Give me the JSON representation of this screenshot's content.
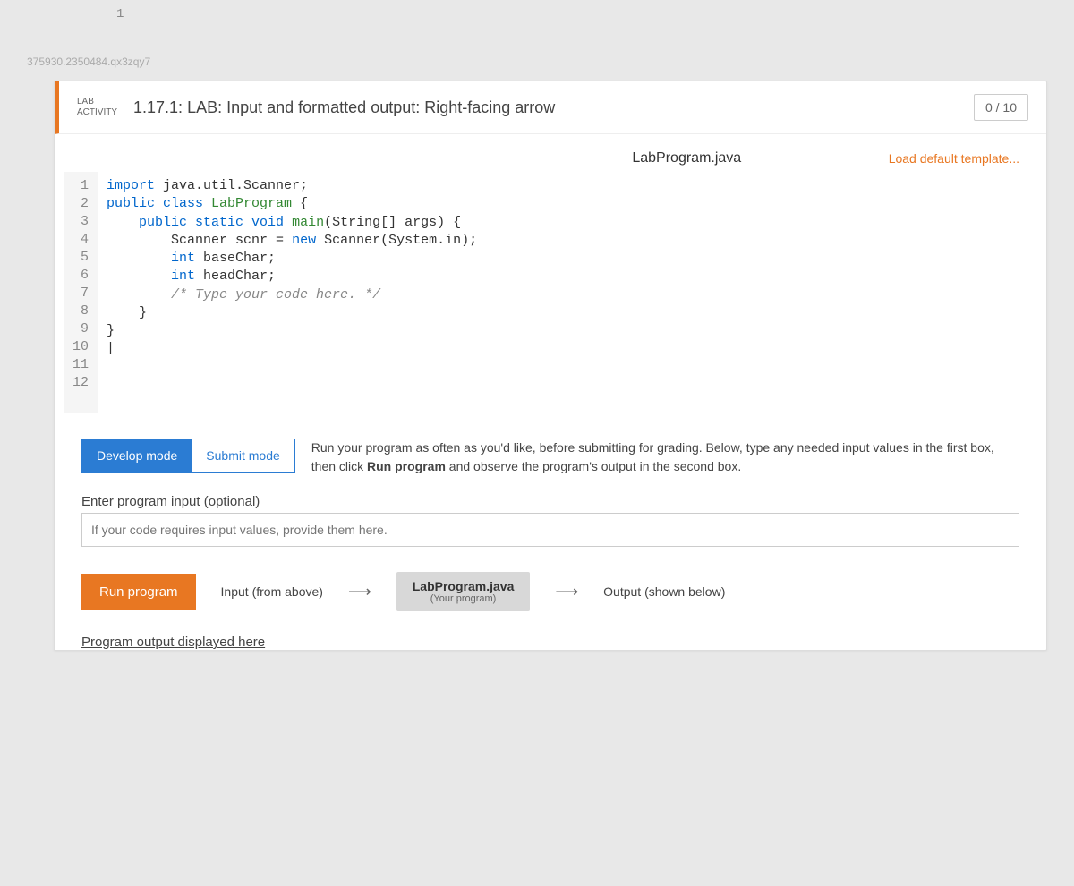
{
  "page_number": "1",
  "watermark": "375930.2350484.qx3zqy7",
  "header": {
    "badge_line1": "LAB",
    "badge_line2": "ACTIVITY",
    "title": "1.17.1: LAB: Input and formatted output: Right-facing arrow",
    "score": "0 / 10"
  },
  "editor_bar": {
    "filename": "LabProgram.java",
    "load_template": "Load default template..."
  },
  "code": {
    "line_numbers": [
      "1",
      "2",
      "3",
      "4",
      "5",
      "6",
      "7",
      "8",
      "9",
      "10",
      "11",
      "12"
    ],
    "l1_a": "import",
    "l1_b": " java.util.Scanner;",
    "l2": "",
    "l3_a": "public class",
    "l3_b": " LabProgram",
    "l3_c": " {",
    "l4_a": "    public static void",
    "l4_b": " main",
    "l4_c": "(String[] args) {",
    "l5_a": "        Scanner scnr = ",
    "l5_b": "new",
    "l5_c": " Scanner(System.in);",
    "l6_a": "        int",
    "l6_b": " baseChar;",
    "l7_a": "        int",
    "l7_b": " headChar;",
    "l8": "",
    "l9_a": "        ",
    "l9_b": "/* Type your code here. */",
    "l10": "    }",
    "l11": "}",
    "l12": "|"
  },
  "modes": {
    "develop": "Develop mode",
    "submit": "Submit mode",
    "desc_a": "Run your program as often as you'd like, before submitting for grading. Below, type any needed input values in the first box, then click ",
    "desc_b": "Run program",
    "desc_c": " and observe the program's output in the second box."
  },
  "input": {
    "label": "Enter program input (optional)",
    "placeholder": "If your code requires input values, provide them here."
  },
  "run": {
    "button": "Run program",
    "input_label": "Input (from above)",
    "program_name": "LabProgram.java",
    "program_desc": "(Your program)",
    "output_label": "Output (shown below)"
  },
  "output_heading": "Program output displayed here"
}
